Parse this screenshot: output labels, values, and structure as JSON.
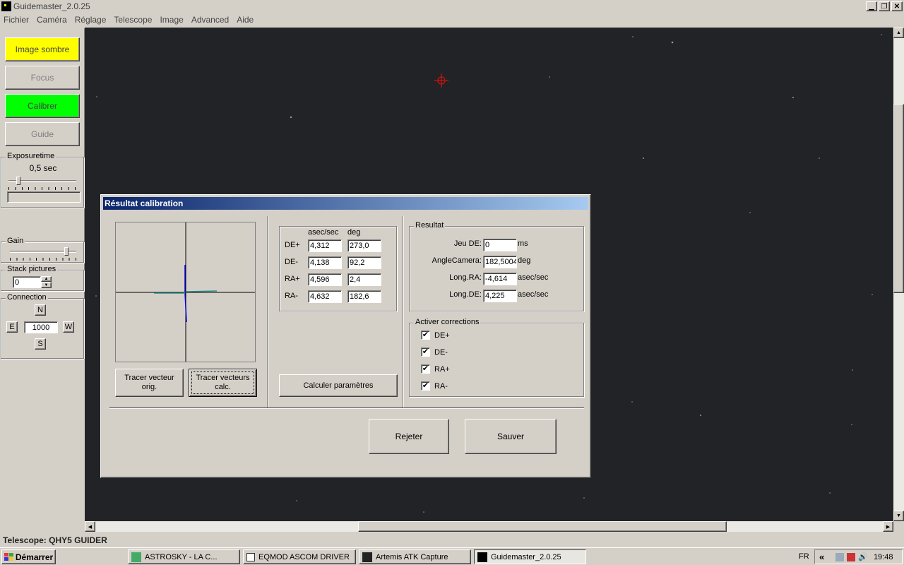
{
  "window": {
    "title": "Guidemaster_2.0.25"
  },
  "menu": [
    "Fichier",
    "Caméra",
    "Réglage",
    "Telescope",
    "Image",
    "Advanced",
    "Aide"
  ],
  "left_panel": {
    "buttons": {
      "dark": "Image sombre",
      "focus": "Focus",
      "calibrate": "Calibrer",
      "guide": "Guide"
    },
    "exposure": {
      "title": "Exposuretime",
      "value": "0,5 sec",
      "slider_fraction": 0.12
    },
    "gain": {
      "title": "Gain",
      "slider_fraction": 0.88
    },
    "stack": {
      "title": "Stack pictures",
      "value": "0"
    },
    "connection": {
      "title": "Connection",
      "n": "N",
      "e": "E",
      "w": "W",
      "s": "S",
      "value": "1000"
    }
  },
  "dialog": {
    "title": "Résultat calibration",
    "buttons": {
      "trace_orig": "Tracer vecteur orig.",
      "trace_calc": "Tracer vecteurs calc.",
      "calc_params": "Calculer paramètres",
      "reject": "Rejeter",
      "save": "Sauver"
    },
    "table": {
      "col_asec": "asec/sec",
      "col_deg": "deg",
      "rows": [
        {
          "label": "DE+",
          "asec": "4,312",
          "deg": "273,0"
        },
        {
          "label": "DE-",
          "asec": "4,138",
          "deg": "92,2"
        },
        {
          "label": "RA+",
          "asec": "4,596",
          "deg": "2,4"
        },
        {
          "label": "RA-",
          "asec": "4,632",
          "deg": "182,6"
        }
      ]
    },
    "result": {
      "title": "Resultat",
      "rows": [
        {
          "label": "Jeu DE:",
          "value": "0",
          "unit": "ms"
        },
        {
          "label": "AngleCamera:",
          "value": "182,5004",
          "unit": "deg"
        },
        {
          "label": "Long.RA:",
          "value": "-4,614",
          "unit": "asec/sec"
        },
        {
          "label": "Long.DE:",
          "value": "4,225",
          "unit": "asec/sec"
        }
      ]
    },
    "corrections": {
      "title": "Activer corrections",
      "items": [
        {
          "label": "DE+",
          "checked": true
        },
        {
          "label": "DE-",
          "checked": true
        },
        {
          "label": "RA+",
          "checked": true
        },
        {
          "label": "RA-",
          "checked": true
        }
      ]
    }
  },
  "status_bar": {
    "text": "Telescope: QHY5 GUIDER"
  },
  "taskbar": {
    "start": "Démarrer",
    "items": [
      {
        "label": "ASTROSKY      -      LA C..."
      },
      {
        "label": "EQMOD ASCOM DRIVER"
      },
      {
        "label": "Artemis ATK Capture"
      },
      {
        "label": "Guidemaster_2.0.25"
      }
    ],
    "lang": "FR",
    "arrows": "«",
    "clock": "19:48"
  },
  "colors": {
    "title_bar": "#0a246a",
    "dark_btn": "#ffff00",
    "calibrate_btn": "#00ff00",
    "star_field": "#222326",
    "target": "#cc1111"
  }
}
